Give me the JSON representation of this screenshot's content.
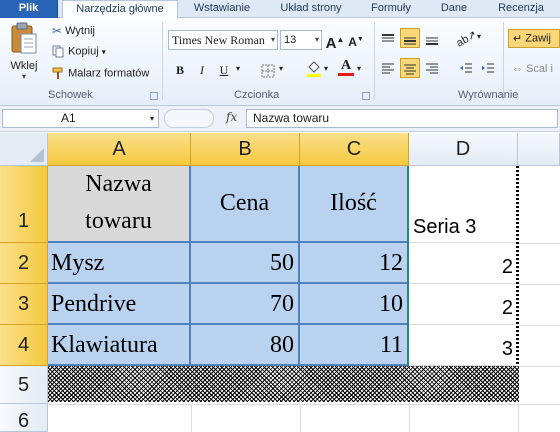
{
  "ribbon_tabs": [
    "Plik",
    "Narzędzia główne",
    "Wstawianie",
    "Układ strony",
    "Formuły",
    "Dane",
    "Recenzja"
  ],
  "clipboard": {
    "paste_label": "Wklej",
    "cut_label": "Wytnij",
    "copy_label": "Kopiuj",
    "format_painter_label": "Malarz formatów",
    "group_label": "Schowek"
  },
  "font": {
    "name": "Times New Roman",
    "size": "13",
    "group_label": "Czcionka",
    "bold": "B",
    "italic": "I",
    "underline": "U",
    "grow": "A",
    "shrink": "A",
    "font_color_letter": "A"
  },
  "alignment": {
    "group_label": "Wyrównanie",
    "wrap_label": "Zawij",
    "merge_label": "Scal i"
  },
  "formula_bar": {
    "name_box": "A1",
    "fx": "fx",
    "formula": "Nazwa towaru"
  },
  "columns": [
    "A",
    "B",
    "C",
    "D"
  ],
  "rows": [
    "1",
    "2",
    "3",
    "4",
    "5",
    "6"
  ],
  "cells": {
    "A1": "Nazwa towaru",
    "B1": "Cena",
    "C1": "Ilość",
    "D1": "Seria 3",
    "A2": "Mysz",
    "B2": "50",
    "C2": "12",
    "D2": "2",
    "A3": "Pendrive",
    "B3": "70",
    "C3": "10",
    "D3": "2",
    "A4": "Klawiatura",
    "B4": "80",
    "C4": "11",
    "D4": "3"
  },
  "colors": {
    "accent": "#2a64b8",
    "selection_header": "#f5c93e",
    "table_fill": "#b8d2f0",
    "table_border": "#4f81bd",
    "header_fill": "#d9d9d9",
    "font_color_bar": "#e01b1b",
    "highlight_bar": "#ffff00"
  }
}
